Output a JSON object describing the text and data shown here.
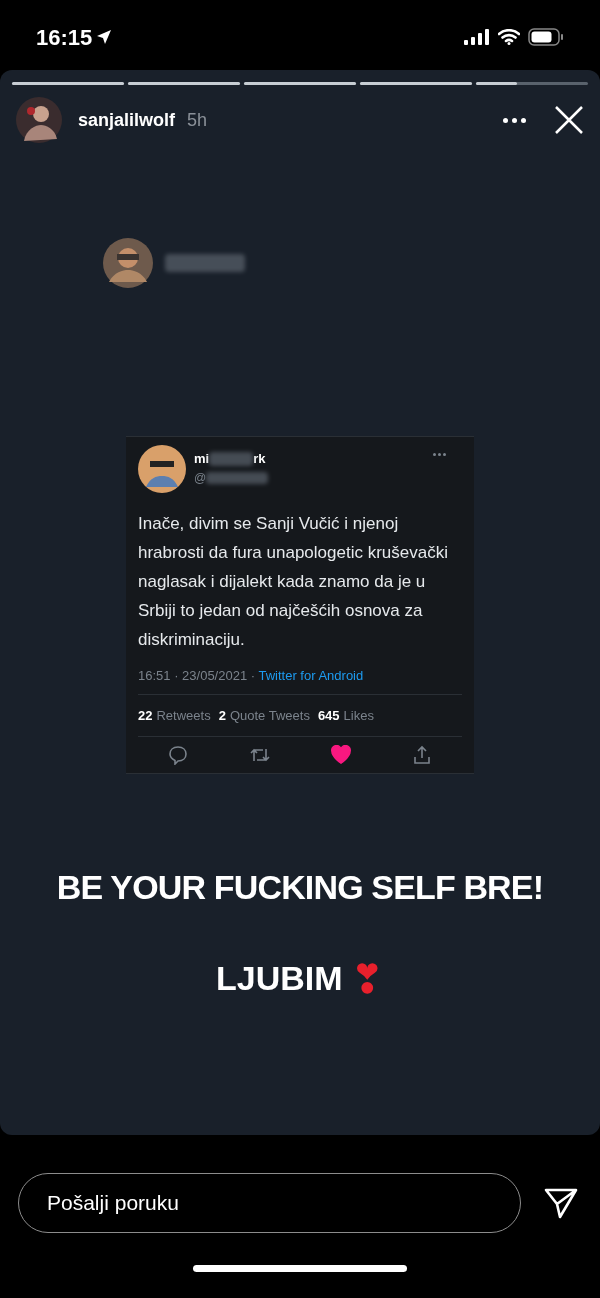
{
  "status_bar": {
    "time": "16:15"
  },
  "story": {
    "progress": [
      {
        "level": 1
      },
      {
        "level": 1
      },
      {
        "level": 1
      },
      {
        "level": 1
      },
      {
        "level": 0.37
      }
    ],
    "username": "sanjalilwolf",
    "age": "5h",
    "tweet": {
      "name_visible": "mi",
      "name_tail": "rk",
      "handle_visible": "@",
      "text": "Inače, divim se Sanji Vučić i njenoj hrabrosti da fura unapologetic kruševački naglasak i dijalekt kada znamo da je u Srbiji to jedan od najčešćih osnova za diskriminaciju.",
      "timestamp": "16:51 · 23/05/2021 · ",
      "source": "Twitter for Android",
      "stats": [
        {
          "count": "22",
          "label": "Retweets"
        },
        {
          "count": "2",
          "label": "Quote Tweets"
        },
        {
          "count": "645",
          "label": "Likes"
        }
      ],
      "liked": true
    },
    "captions": [
      "BE YOUR FUCKING SELF BRE!",
      "LJUBIM"
    ],
    "emoji": "❣"
  },
  "reply": {
    "placeholder": "Pošalji poruku"
  }
}
